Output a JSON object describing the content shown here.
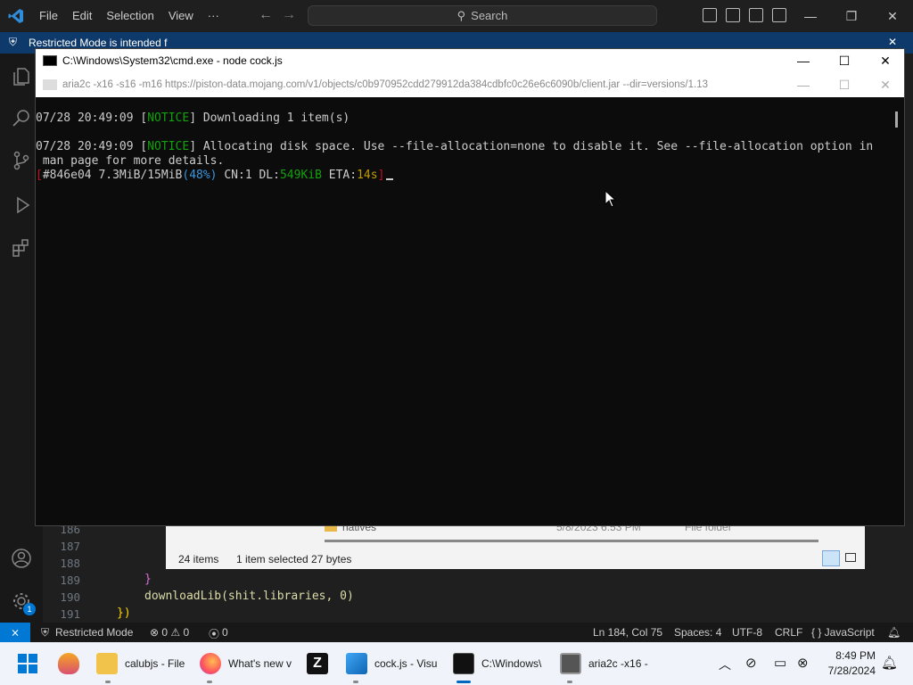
{
  "vscode": {
    "menu": [
      "File",
      "Edit",
      "Selection",
      "View",
      "···"
    ],
    "search_placeholder": "Search",
    "banner_text": "Restricted Mode is intended f",
    "line_numbers": [
      "186",
      "187",
      "188",
      "189",
      "190",
      "191"
    ],
    "code_lines": [
      "}",
      "downloadLib(shit.libraries, 0)",
      "})"
    ]
  },
  "explorer": {
    "folder_name": "natives",
    "folder_date": "5/8/2023 6:53 PM",
    "folder_type": "File folder",
    "item_count": "24 items",
    "selection": "1 item selected  27 bytes"
  },
  "cmd": {
    "title": "C:\\Windows\\System32\\cmd.exe - node  cock.js",
    "subtitle": "aria2c  -x16 -s16 -m16 https://piston-data.mojang.com/v1/objects/c0b970952cdd279912da384cdbfc0c26e6c6090b/client.jar --dir=versions/1.13",
    "lines": {
      "l1_time": "07/28 20:49:09 [",
      "l1_tag": "NOTICE",
      "l1_rest": "] Downloading 1 item(s)",
      "l2_time": "07/28 20:49:09 [",
      "l2_tag": "NOTICE",
      "l2_rest": "] Allocating disk space. Use --file-allocation=none to disable it. See --file-allocation option in",
      "l3": " man page for more details.",
      "p_open": "[",
      "p_id": "#846e04 7.3MiB/15MiB",
      "p_pct": "(48%)",
      "p_cn": " CN:1 DL:",
      "p_dl": "549KiB",
      "p_eta": " ETA:",
      "p_eta_val": "14s",
      "p_close": "]"
    }
  },
  "status": {
    "remote_icon": "remote-icon",
    "restricted": "Restricted Mode",
    "problems": "⊗ 0 ⚠ 0",
    "ports": "0",
    "position": "Ln 184, Col 75",
    "spaces": "Spaces: 4",
    "encoding": "UTF-8",
    "eol": "CRLF",
    "language": "{ } JavaScript"
  },
  "taskbar": {
    "items": [
      "calubjs - File",
      "What's new v",
      "cock.js - Visu",
      "C:\\Windows\\",
      "aria2c  -x16 -"
    ],
    "time": "8:49 PM",
    "date": "7/28/2024"
  },
  "colors": {
    "accent": "#0078d4",
    "notice": "#13a10e",
    "percent": "#3a96dd",
    "eta": "#c19c00"
  }
}
